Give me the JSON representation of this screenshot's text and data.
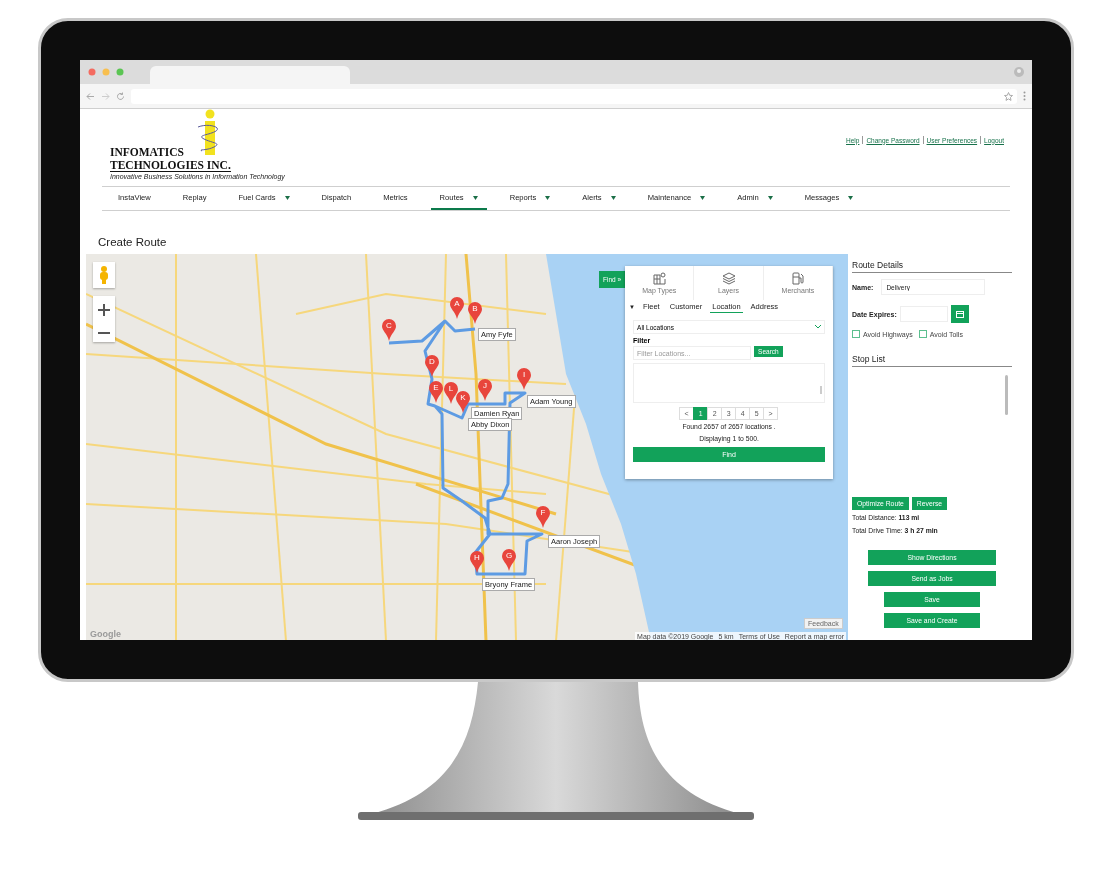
{
  "header": {
    "logo": {
      "line_1": "INFOMATICS",
      "line_2": "TECHNOLOGIES INC.",
      "tagline": "Innovative Business Solutions in Information Technology"
    },
    "links": [
      "Help",
      "Change Password",
      "User Preferences",
      "Logout"
    ]
  },
  "nav": {
    "items": [
      {
        "label": "InstaView",
        "has_menu": false,
        "selected": false
      },
      {
        "label": "Replay",
        "has_menu": false,
        "selected": false
      },
      {
        "label": "Fuel Cards",
        "has_menu": true,
        "selected": false
      },
      {
        "label": "Dispatch",
        "has_menu": false,
        "selected": false
      },
      {
        "label": "Metrics",
        "has_menu": false,
        "selected": false
      },
      {
        "label": "Routes",
        "has_menu": true,
        "selected": true
      },
      {
        "label": "Reports",
        "has_menu": true,
        "selected": false
      },
      {
        "label": "Alerts",
        "has_menu": true,
        "selected": false
      },
      {
        "label": "Maintenance",
        "has_menu": true,
        "selected": false
      },
      {
        "label": "Admin",
        "has_menu": true,
        "selected": false
      },
      {
        "label": "Messages",
        "has_menu": true,
        "selected": false
      }
    ]
  },
  "page_title": "Create Route",
  "map": {
    "markers": [
      {
        "letter": "A"
      },
      {
        "letter": "B"
      },
      {
        "letter": "C"
      },
      {
        "letter": "D"
      },
      {
        "letter": "E"
      },
      {
        "letter": "F"
      },
      {
        "letter": "G"
      },
      {
        "letter": "H"
      },
      {
        "letter": "I"
      },
      {
        "letter": "J"
      },
      {
        "letter": "K"
      },
      {
        "letter": "L"
      }
    ],
    "stop_labels": [
      "Amy Fyfe",
      "Adam Young",
      "Damien Ryan",
      "Abby Dixon",
      "Aaron Joseph",
      "Bryony Frame"
    ],
    "logo": "Google",
    "feedback": "Feedback",
    "attribution": [
      "Map data ©2019 Google",
      "5 km",
      "Terms of Use",
      "Report a map error"
    ]
  },
  "find_panel": {
    "toggle": "Find »",
    "tools": [
      "Map Types",
      "Layers",
      "Merchants"
    ],
    "collapse": "▼",
    "tabs": [
      {
        "label": "Fleet",
        "selected": false
      },
      {
        "label": "Customer",
        "selected": false
      },
      {
        "label": "Location",
        "selected": true
      },
      {
        "label": "Address",
        "selected": false
      }
    ],
    "dropdown": "All Locations",
    "filter_label": "Filter",
    "filter_placeholder": "Filter Locations...",
    "search_button": "Search",
    "pagination": {
      "prev": "<",
      "pages": [
        {
          "label": "1",
          "selected": true
        },
        {
          "label": "2",
          "selected": false
        },
        {
          "label": "3",
          "selected": false
        },
        {
          "label": "4",
          "selected": false
        },
        {
          "label": "5",
          "selected": false
        }
      ],
      "next": ">"
    },
    "summary": [
      "Found 2657 of 2657 locations .",
      "Displaying 1 to 500."
    ],
    "find_button": "Find"
  },
  "route_details": {
    "title": "Route Details",
    "name_label": "Name:",
    "name_value": "Delivery",
    "date_label": "Date Expires:",
    "options": [
      {
        "label": "Avoid Highways",
        "checked": false
      },
      {
        "label": "Avoid Tolls",
        "checked": false
      }
    ],
    "stop_list_title": "Stop List",
    "optimize_button": "Optimize Route",
    "reverse_button": "Reverse",
    "totals": [
      "Total Distance: **113 mi**",
      "Total Drive Time: **3 h 27 min**"
    ],
    "actions": [
      {
        "label": "Show Directions",
        "kind": "wide"
      },
      {
        "label": "Send as Jobs",
        "kind": "wide"
      },
      {
        "label": "Save",
        "kind": "narrow"
      },
      {
        "label": "Save and Create",
        "kind": "narrow"
      }
    ]
  }
}
